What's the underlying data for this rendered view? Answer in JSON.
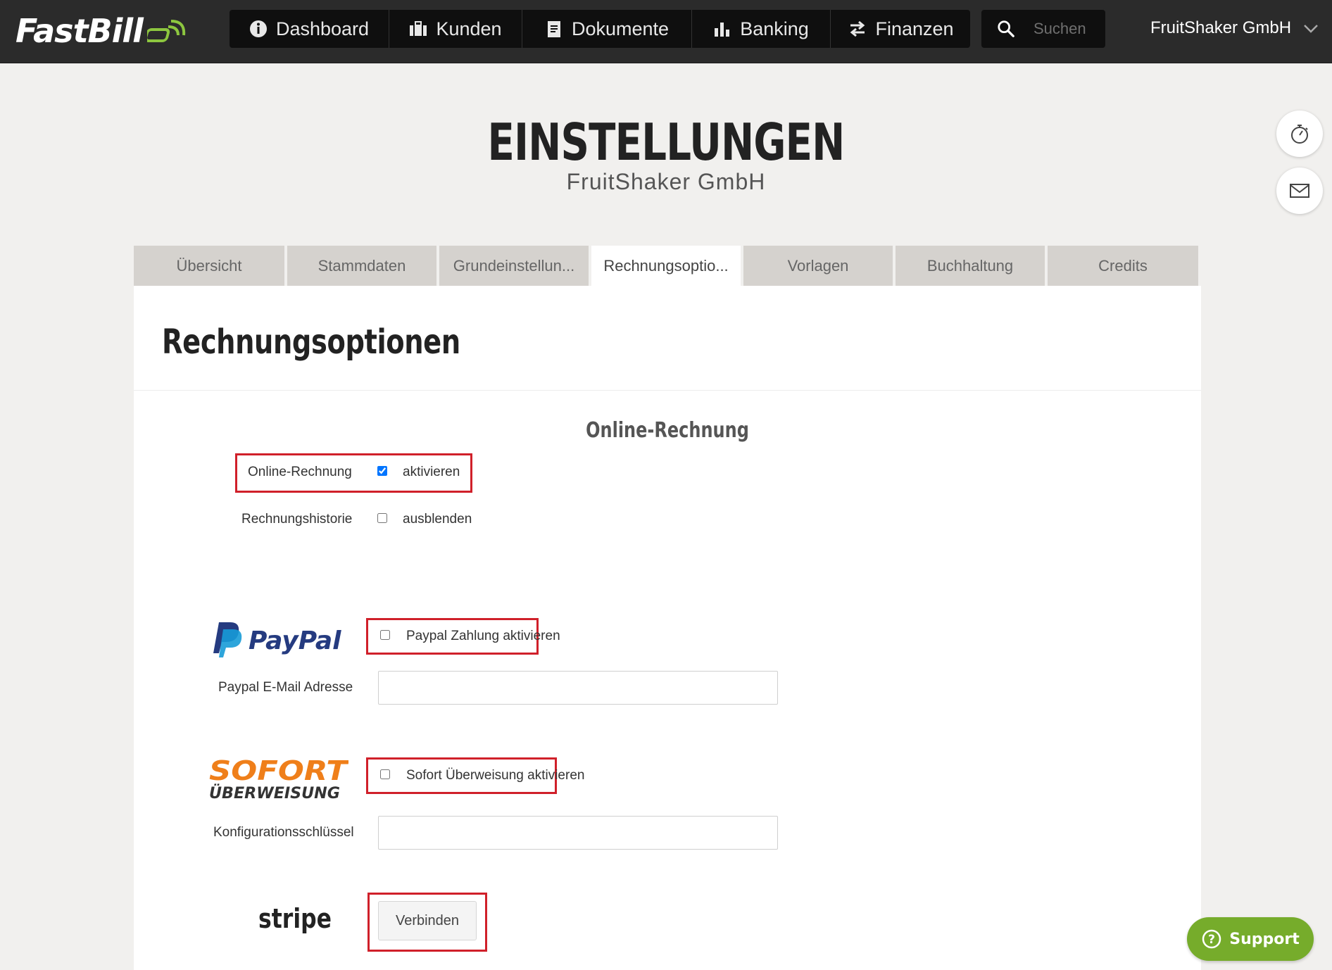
{
  "app": {
    "logo_text": "FastBill",
    "account_name": "FruitShaker GmbH"
  },
  "nav": {
    "items": [
      {
        "label": "Dashboard",
        "icon": "dashboard-icon"
      },
      {
        "label": "Kunden",
        "icon": "briefcase-icon"
      },
      {
        "label": "Dokumente",
        "icon": "document-icon"
      },
      {
        "label": "Banking",
        "icon": "bar-chart-icon"
      },
      {
        "label": "Finanzen",
        "icon": "transfer-arrows-icon"
      }
    ],
    "search_placeholder": "Suchen"
  },
  "page": {
    "title": "EINSTELLUNGEN",
    "subtitle": "FruitShaker GmbH"
  },
  "tabs": [
    {
      "label": "Übersicht",
      "active": false
    },
    {
      "label": "Stammdaten",
      "active": false
    },
    {
      "label": "Grundeinstellun...",
      "active": false
    },
    {
      "label": "Rechnungsoptio...",
      "active": true
    },
    {
      "label": "Vorlagen",
      "active": false
    },
    {
      "label": "Buchhaltung",
      "active": false
    },
    {
      "label": "Credits",
      "active": false
    }
  ],
  "panel": {
    "title": "Rechnungsoptionen",
    "section_title": "Online-Rechnung",
    "online_invoice": {
      "label": "Online-Rechnung",
      "checkbox_label": "aktivieren",
      "checked": true
    },
    "invoice_history": {
      "label": "Rechnungshistorie",
      "checkbox_label": "ausblenden",
      "checked": false
    },
    "paypal": {
      "logo_text": "PayPal",
      "checkbox_label": "Paypal Zahlung aktivieren",
      "checked": false,
      "email_label": "Paypal E-Mail Adresse",
      "email_value": ""
    },
    "sofort": {
      "logo_line1": "SOFORT",
      "logo_line2": "ÜBERWEISUNG",
      "checkbox_label": "Sofort Überweisung aktivieren",
      "checked": false,
      "key_label": "Konfigurationsschlüssel",
      "key_value": ""
    },
    "stripe": {
      "logo_text": "stripe",
      "connect_label": "Verbinden"
    }
  },
  "side": {
    "timer_icon": "stopwatch-icon",
    "mail_icon": "envelope-icon"
  },
  "support": {
    "label": "Support"
  },
  "colors": {
    "topbar": "#2b2b2b",
    "highlight_red": "#d0202a",
    "support_green": "#76ac2b",
    "paypal_dark": "#253b80",
    "paypal_light": "#179bd7",
    "sofort_orange": "#ef7f1a"
  }
}
